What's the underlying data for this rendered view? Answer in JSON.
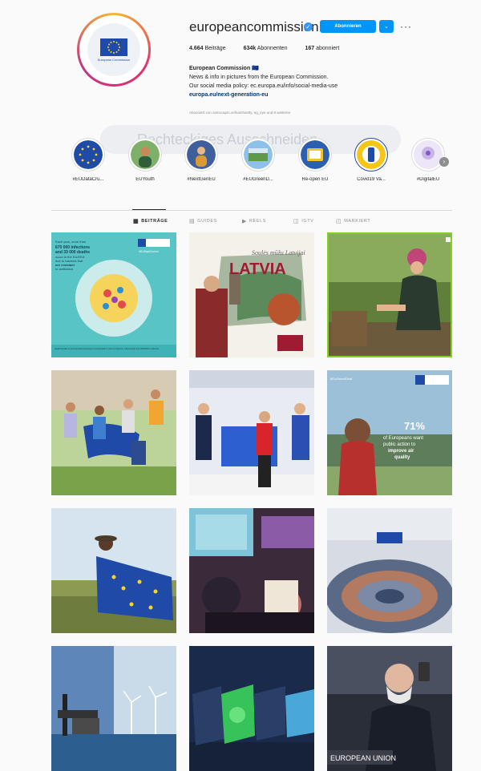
{
  "profile": {
    "username": "europeancommission",
    "follow_label": "Abonnieren",
    "dropdown_glyph": "⌄",
    "more_glyph": "···",
    "verified_glyph": "✓",
    "avatar_text": "European Commission"
  },
  "stats": {
    "posts_count": "4.664",
    "posts_label": "Beiträge",
    "followers_count": "634k",
    "followers_label": "Abonnenten",
    "following_count": "167",
    "following_label": "abonniert"
  },
  "bio": {
    "name": "European Commission 🇪🇺",
    "line1": "News & info in pictures from the European Commission.",
    "line2": "Our social media policy: ec.europa.eu/info/social-media-use",
    "link": "europa.eu/next-generation-eu",
    "followed_by": "Abonniert von camscapm.vehiamhantly, eg_eye und 8 weiteren"
  },
  "search_overlay": "Rechteckiges Ausschneiden",
  "highlights": [
    {
      "label": "#EUDataCru...",
      "color": "#1f4aa8"
    },
    {
      "label": "EUYouth",
      "color": "#3b7a3a"
    },
    {
      "label": "#NextGenEU",
      "color": "#4a6fb5"
    },
    {
      "label": "#EUGreenD...",
      "color": "#6aa2d8"
    },
    {
      "label": "Re-open EU",
      "color": "#2d5fb0"
    },
    {
      "label": "Covid19 Va...",
      "color": "#f5c518"
    },
    {
      "label": "#DigitalEU",
      "color": "#c8b4e6"
    }
  ],
  "tabs": [
    {
      "label": "BEITRÄGE",
      "icon": "grid-icon"
    },
    {
      "label": "GUIDES",
      "icon": "guides-icon"
    },
    {
      "label": "REELS",
      "icon": "reels-icon"
    },
    {
      "label": "IGTV",
      "icon": "igtv-icon"
    },
    {
      "label": "MARKIERT",
      "icon": "tagged-icon"
    }
  ],
  "posts": {
    "p1_text1": "Each year, more than",
    "p1_text2": "670 000 infections",
    "p1_text3": "and 33 000 deaths",
    "p1_text4": "occur in the EU/EEA",
    "p1_text5": "due to bacteria that",
    "p1_text6": "are resistant",
    "p1_text7": "to antibiotics",
    "p1_tag": "#EUDataCrunch",
    "p1_foot": "Health burden of antimicrobial resistance is comparable to that of influenza, tuberculosis and HIV/AIDS combined",
    "p2_script": "Soulės mūžu Latvijai",
    "p2_title": "LATVIA",
    "p6_tag": "#EUGreenDeal",
    "p6_big": "71%",
    "p6_text1": "of Europeans want",
    "p6_text2": "public action to",
    "p6_text3": "improve air",
    "p6_text4": "quality",
    "p12_sign": "EUROPEAN UNION"
  }
}
